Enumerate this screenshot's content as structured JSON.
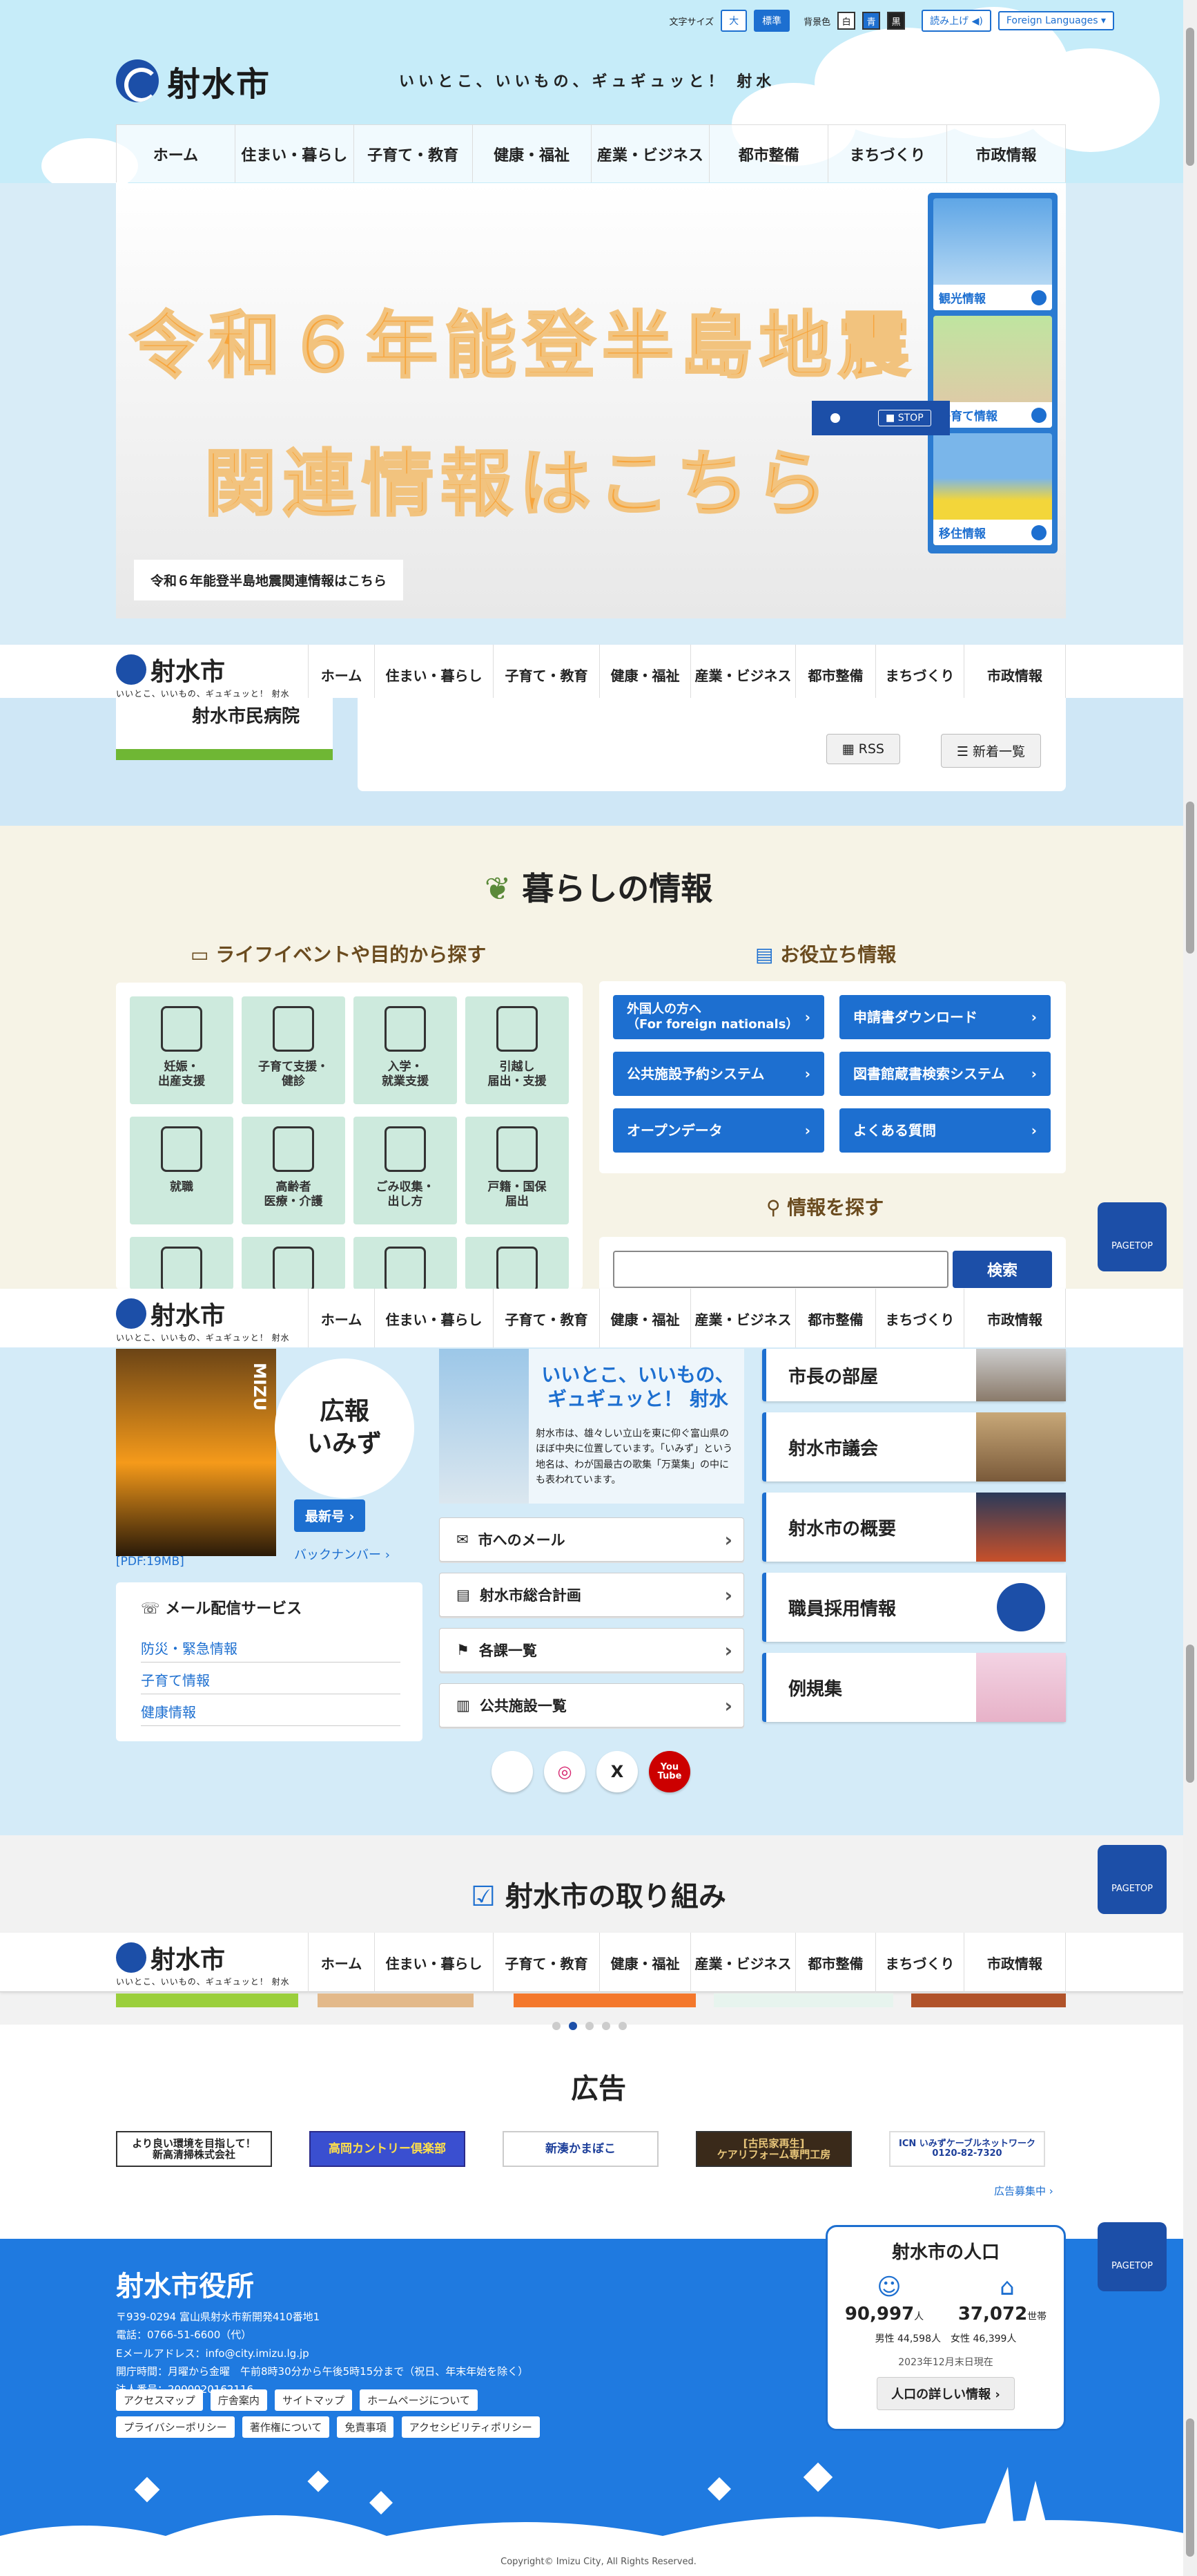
{
  "topbar": {
    "font_size_label": "文字サイズ",
    "font_large": "大",
    "font_standard": "標準",
    "bg_label": "背景色",
    "bg_white": "白",
    "bg_blue": "青",
    "bg_black": "黒",
    "read_aloud": "読み上げ",
    "languages": "Foreign Languages"
  },
  "site": {
    "name": "射水市",
    "tagline": "いいとこ、いいもの、ギュギュッと！ 射水",
    "sticky_tagline": "いいとこ、いいもの、ギュギュッと！ 射水"
  },
  "nav": [
    "ホーム",
    "住まい・暮らし",
    "子育て・教育",
    "健康・福祉",
    "産業・ビジネス",
    "都市整備",
    "まちづくり",
    "市政情報"
  ],
  "hero": {
    "line1": "令和６年能登半島地震",
    "line2": "関連情報はこちら",
    "caption": "令和６年能登半島地震関連情報はこちら",
    "side": [
      "観光情報",
      "子育て情報",
      "移住情報"
    ],
    "stop": "STOP"
  },
  "news": {
    "hospital": "射水市民病院",
    "rss": "RSS",
    "all": "新着一覧"
  },
  "life": {
    "title": "暮らしの情報",
    "lifeevent_title": "ライフイベントや目的から探す",
    "tiles": [
      "妊娠・\n出産支援",
      "子育て支援・\n健診",
      "入学・\n就業支援",
      "引越し\n届出・支援",
      "就職",
      "高齢者\n医療・介護",
      "ごみ収集・\n出し方",
      "戸籍・国保\n届出"
    ],
    "useful_title": "お役立ち情報",
    "useful": [
      "外国人の方へ\n（For foreign nationals）",
      "申請書ダウンロード",
      "公共施設予約システム",
      "図書館蔵書検索システム",
      "オープンデータ",
      "よくある質問"
    ],
    "search_title": "情報を探す",
    "search_button": "検索",
    "pagetop": "PAGETOP"
  },
  "kouhou": {
    "cover_label": "MIZU",
    "title": "広報\nいみず",
    "latest": "最新号",
    "backnumber": "バックナンバー",
    "pdf": "[PDF:19MB]",
    "intro_title": "いいとこ、いいもの、\nギュギュッと！ 射水",
    "intro_text": "射水市は、雄々しい立山を東に仰ぐ富山県のほぼ中央に位置しています。「いみず」という地名は、わが国最古の歌集「万葉集」の中にも表われています。",
    "links": [
      "市へのメール",
      "射水市総合計画",
      "各課一覧",
      "公共施設一覧"
    ],
    "cards": [
      "市長の部屋",
      "射水市議会",
      "射水市の概要",
      "職員採用情報",
      "例規集"
    ],
    "mail_title": "メール配信サービス",
    "mail_links": [
      "防災・緊急情報",
      "子育て情報",
      "健康情報"
    ],
    "sns": [
      "",
      "",
      "X",
      "You\nTube"
    ]
  },
  "torikumi": {
    "title": "射水市の取り組み"
  },
  "ads": {
    "title": "広告",
    "items": [
      "より良い環境を目指して！\n新高清掃株式会社",
      "高岡カントリー倶楽部",
      "新湊かまぼこ",
      "[古民家再生]\nケアリフォーム専門工房",
      "ICN いみずケーブルネットワーク\n0120-82-7320"
    ],
    "recruit": "広告募集中"
  },
  "footer": {
    "title": "射水市役所",
    "address": "〒939-0294 富山県射水市新開発410番地1",
    "tel": "電話：0766-51-6600（代）",
    "email": "Eメールアドレス：info@city.imizu.lg.jp",
    "hours": "開庁時間：月曜から金曜　午前8時30分から午後5時15分まで（祝日、年末年始を除く）",
    "corp": "法人番号：2000020162116",
    "links": [
      "アクセスマップ",
      "庁舎案内",
      "サイトマップ",
      "ホームページについて",
      "プライバシーポリシー",
      "著作権について",
      "免責事項",
      "アクセシビリティポリシー"
    ],
    "copyright": "Copyright© Imizu City, All Rights Reserved."
  },
  "population": {
    "title": "射水市の人口",
    "total": "90,997",
    "total_unit": "人",
    "households": "37,072",
    "households_unit": "世帯",
    "male": "男性 44,598人",
    "female": "女性 46,399人",
    "as_of": "2023年12月末日現在",
    "detail": "人口の詳しい情報"
  }
}
